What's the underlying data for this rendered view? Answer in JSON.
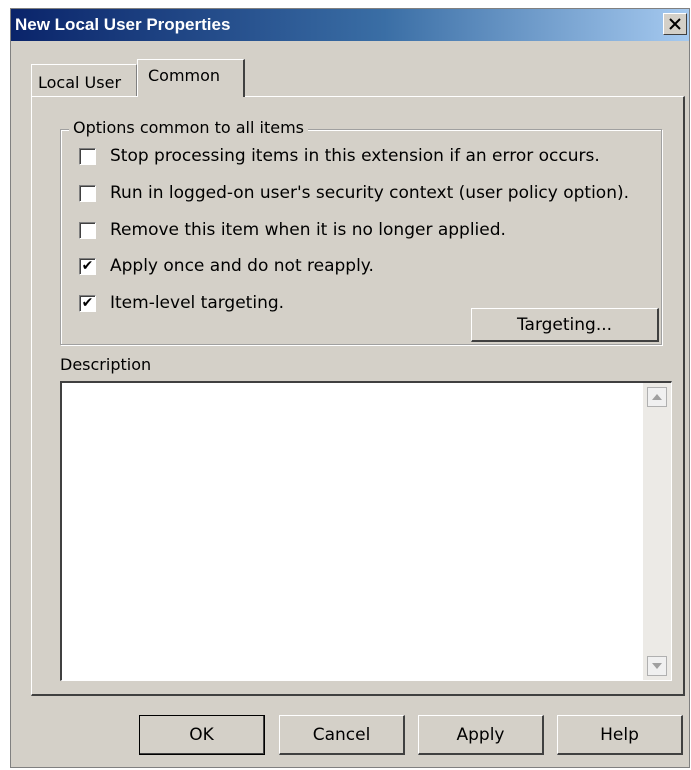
{
  "window": {
    "title": "New Local User Properties",
    "close_glyph": "✕"
  },
  "tabs": [
    {
      "label": "Local User",
      "active": false
    },
    {
      "label": "Common",
      "active": true
    }
  ],
  "options_group": {
    "legend": "Options common to all items",
    "checkboxes": [
      {
        "label": "Stop processing items in this extension if an error occurs.",
        "checked": false,
        "mark": ""
      },
      {
        "label": "Run in logged-on user's security context (user policy option).",
        "checked": false,
        "mark": ""
      },
      {
        "label": "Remove this item when it is no longer applied.",
        "checked": false,
        "mark": ""
      },
      {
        "label": "Apply once and do not reapply.",
        "checked": true,
        "mark": "✔"
      },
      {
        "label": "Item-level targeting.",
        "checked": true,
        "mark": "✔"
      }
    ],
    "targeting_button": "Targeting..."
  },
  "description": {
    "label": "Description",
    "value": ""
  },
  "buttons": {
    "ok": "OK",
    "cancel": "Cancel",
    "apply": "Apply",
    "help": "Help"
  }
}
